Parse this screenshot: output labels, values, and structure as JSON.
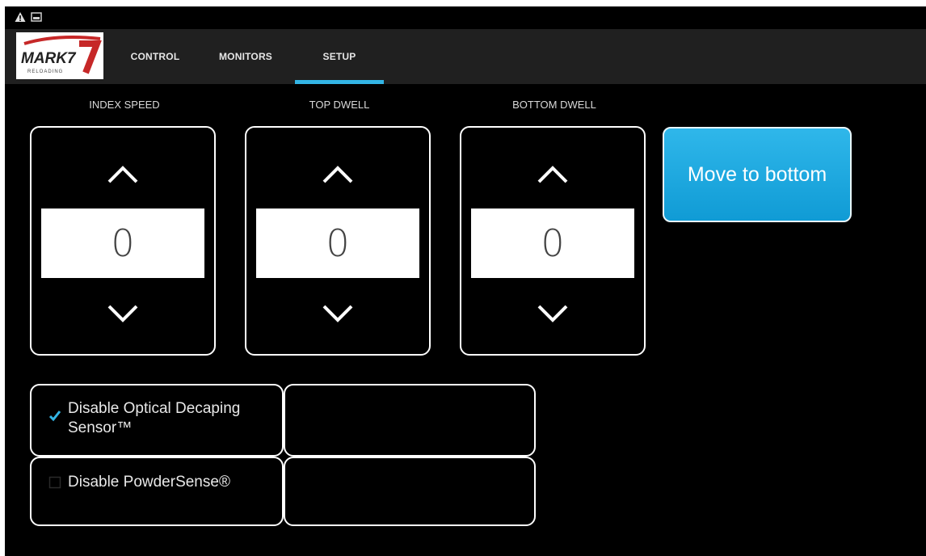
{
  "colors": {
    "accent": "#33b5e5",
    "button": "#1aa7de"
  },
  "status_bar": {
    "icons": [
      "warning-icon",
      "image-icon"
    ]
  },
  "header": {
    "logo_text": "MARK7",
    "logo_subtext": "RELOADING",
    "tabs": [
      {
        "label": "CONTROL",
        "selected": false
      },
      {
        "label": "MONITORS",
        "selected": false
      },
      {
        "label": "SETUP",
        "selected": true
      }
    ]
  },
  "spinners": [
    {
      "label": "INDEX SPEED",
      "value": "0"
    },
    {
      "label": "TOP DWELL",
      "value": "0"
    },
    {
      "label": "BOTTOM DWELL",
      "value": "0"
    }
  ],
  "move_button": {
    "label": "Move to bottom"
  },
  "options": [
    {
      "label": "Disable Optical Decaping Sensor™",
      "checked": true
    },
    {
      "label": "Disable PowderSense®",
      "checked": false
    }
  ]
}
